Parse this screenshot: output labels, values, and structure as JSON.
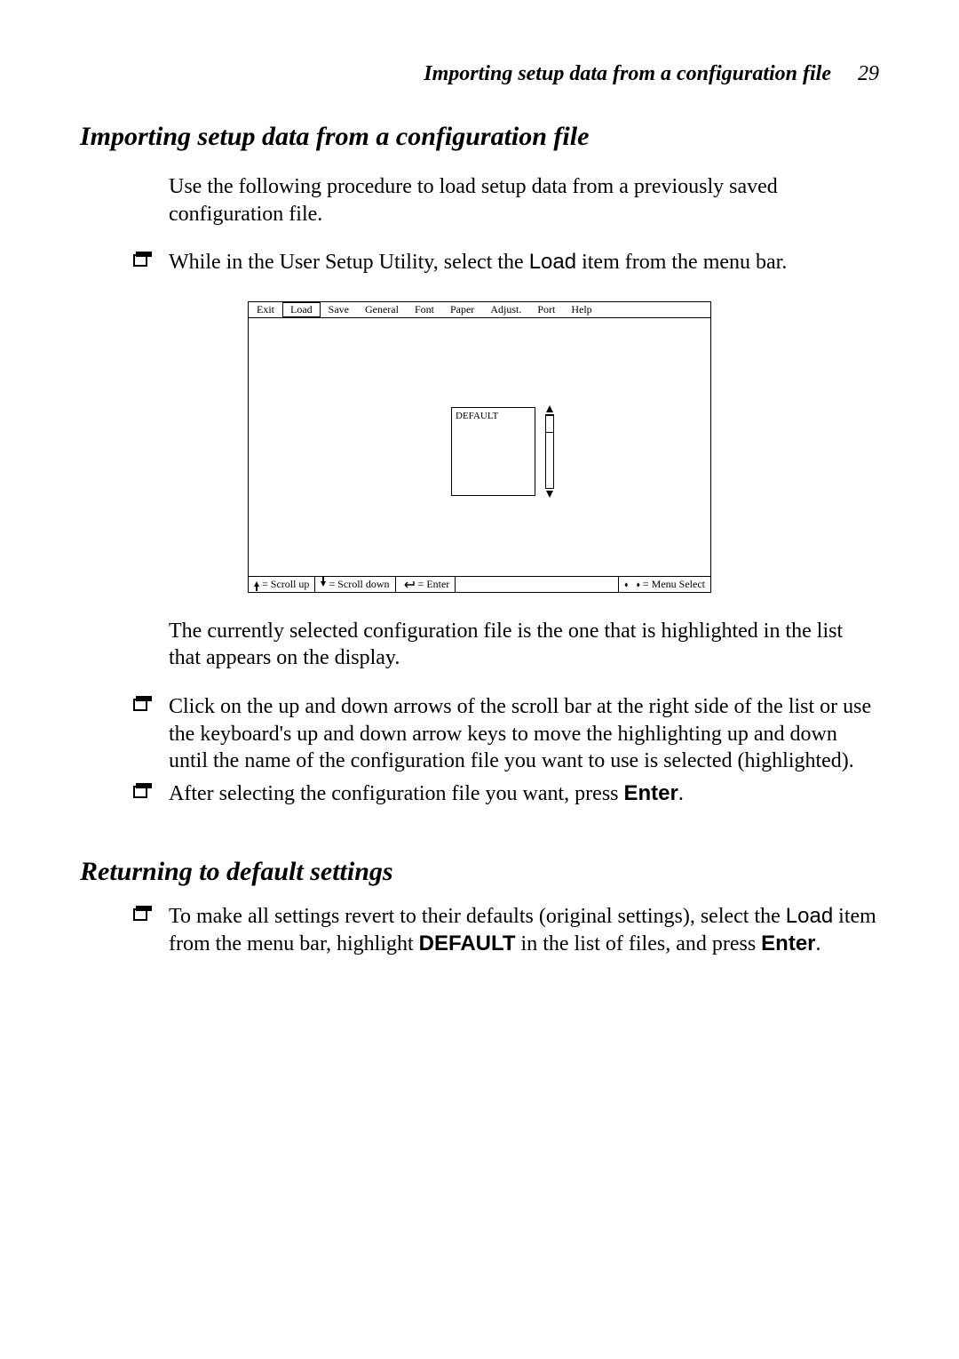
{
  "header": {
    "running_title": "Importing setup data from a configuration file",
    "page_number": "29"
  },
  "section1": {
    "title": "Importing setup data from a configuration file",
    "intro": "Use the following procedure to load setup data from a previously saved configuration file.",
    "step1_pre": "While in the User Setup Utility, select the ",
    "step1_load": "Load",
    "step1_post": " item from the menu bar.",
    "after_diagram": "The currently selected configuration file is the one that is highlighted in the list that appears on the display.",
    "step2": "Click on the up and down arrows of the scroll bar at the right side of the list or use the keyboard's up and down arrow keys to move the highlighting up and down until the name of the configuration file you want to use is selected (highlighted).",
    "step3_pre": "After selecting the configuration file you want, press ",
    "step3_enter": "Enter",
    "step3_post": "."
  },
  "section2": {
    "title": "Returning to default settings",
    "step1_a": "To make all settings revert to their defaults (original settings), select the ",
    "step1_load": "Load",
    "step1_b": " item from the menu bar, highlight ",
    "step1_default": "DEFAULT",
    "step1_c": " in the list of files, and press ",
    "step1_enter": "Enter",
    "step1_d": "."
  },
  "diagram": {
    "menu": [
      "Exit",
      "Load",
      "Save",
      "General",
      "Font",
      "Paper",
      "Adjust.",
      "Port",
      "Help"
    ],
    "selected_menu_index": 1,
    "list_item": "DEFAULT",
    "status": {
      "scroll_up": " = Scroll up",
      "scroll_down": " = Scroll down",
      "enter": " = Enter",
      "menu_select": " = Menu Select"
    }
  }
}
